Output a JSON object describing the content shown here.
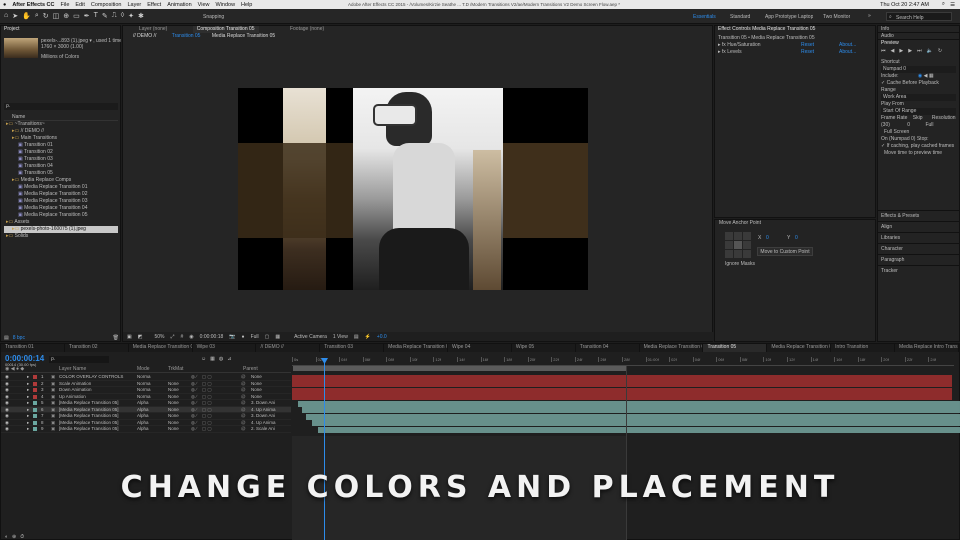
{
  "menubar": {
    "apple": "",
    "app": "After Effects CC",
    "items": [
      "File",
      "Edit",
      "Composition",
      "Layer",
      "Effect",
      "Animation",
      "View",
      "Window",
      "Help"
    ],
    "window_title": "Adobe After Effects CC 2015 - /Volumes/Kirzie Seathe ... T.D /Modern Transitions V2/ae/Modern Transitions V2 Demo Screen Flow.aep *",
    "datetime": "Thu Oct 20  2:47 AM"
  },
  "toolbar": {
    "snapping": "Snapping",
    "workspaces": [
      "Essentials",
      "Standard",
      "App Prototype Laptop",
      "Two Monitor"
    ],
    "search": "Search Help"
  },
  "project": {
    "tab": "Project",
    "thumb_name": "pexels-...893 (1).jpeg ▾ , used 1 time",
    "thumb_size": "1760 × 3000 (1.00)",
    "thumb_colors": "Millions of Colors",
    "search": "ρ.",
    "col_name": "Name",
    "items": [
      {
        "label": "~Transitions~",
        "indent": 0
      },
      {
        "label": "// DEMO //",
        "indent": 1
      },
      {
        "label": "Main Transitions",
        "indent": 1
      },
      {
        "label": "Transition 01",
        "indent": 2
      },
      {
        "label": "Transition 02",
        "indent": 2
      },
      {
        "label": "Transition 03",
        "indent": 2
      },
      {
        "label": "Transition 04",
        "indent": 2
      },
      {
        "label": "Transition 05",
        "indent": 2
      },
      {
        "label": "Media Replace Comps",
        "indent": 1
      },
      {
        "label": "Media Replace Transition 01",
        "indent": 2
      },
      {
        "label": "Media Replace Transition 02",
        "indent": 2
      },
      {
        "label": "Media Replace Transition 03",
        "indent": 2
      },
      {
        "label": "Media Replace Transition 04",
        "indent": 2
      },
      {
        "label": "Media Replace Transition 05",
        "indent": 2
      },
      {
        "label": "Assets",
        "indent": 0
      },
      {
        "label": "pexels-photo-160075 (1).jpeg",
        "indent": 1
      },
      {
        "label": "Solids",
        "indent": 0
      }
    ],
    "bpc": "8 bpc"
  },
  "viewer": {
    "tabs": [
      "Layer (none)",
      "Composition Transition 05",
      "Footage (none)"
    ],
    "breadcrumbs": [
      "// DEMO //",
      "Transition 05",
      "Media Replace Transition 05"
    ],
    "zoom": "50%",
    "timecode": "0:00:00:18",
    "resolution": "Full",
    "camera": "Active Camera",
    "views": "1 View",
    "offset": "+0.0"
  },
  "effects": {
    "tab": "Effect Controls Media Replace Transition 05",
    "header": "Transition 05 • Media Replace Transition 05",
    "rows": [
      {
        "name": "Hue/Saturation",
        "reset": "Reset",
        "about": "About..."
      },
      {
        "name": "Levels",
        "reset": "Reset",
        "about": "About..."
      }
    ],
    "anchor_title": "Move Anchor Point",
    "x_label": "X",
    "x_val": "0",
    "y_label": "Y",
    "y_val": "0",
    "move_button": "Move to Custom Point",
    "ignore_masks": "Ignore Masks"
  },
  "right": {
    "tabs": [
      "Info",
      "Audio"
    ],
    "preview_title": "Preview",
    "shortcut_label": "Shortcut",
    "shortcut_value": "Numpad 0",
    "include_label": "Include:",
    "cache_label": "Cache Before Playback",
    "range_label": "Range",
    "range_value": "Work Area",
    "playfrom_label": "Play From",
    "playfrom_value": "Start Of Range",
    "framerate_label": "Frame Rate",
    "skip_label": "Skip",
    "resolution_label": "Resolution",
    "framerate_value": "(30)",
    "skip_value": "0",
    "resolution_value": "Full",
    "fullscreen": "Full Screen",
    "onstop_label": "On (Numpad 0) Stop:",
    "ifcaching": "If caching, play cached frames",
    "movetime": "Move time to preview time",
    "panels": [
      "Effects & Presets",
      "Align",
      "Libraries",
      "Character",
      "Paragraph",
      "Tracker"
    ]
  },
  "timeline": {
    "tabs": [
      "Transition 01",
      "Transition 02",
      "Media Replace Transition 02",
      "Wipe 03",
      "// DEMO //",
      "Transition 03",
      "Media Replace Transition 03",
      "Wipe 04",
      "Wipe 05",
      "Transition 04",
      "Media Replace Transition 04",
      "Transition 05",
      "Media Replace Transition 05",
      "Intro Transition",
      "Media Replace Intro Trans"
    ],
    "active_tab": 11,
    "timecode": "0:00:00:14",
    "fps": "00014 (30.00 fps)",
    "search": "ρ.",
    "col_layer": "Layer Name",
    "col_mode": "Mode",
    "col_trkmat": "TrkMat",
    "col_parent": "Parent",
    "layers": [
      {
        "num": "1",
        "name": "COLOR OVERLAY CONTROLS",
        "mode": "Norma",
        "trk": "",
        "parent": "None",
        "color": "#b03a3a"
      },
      {
        "num": "2",
        "name": "Scale Animation",
        "mode": "Norma",
        "trk": "None",
        "parent": "None",
        "color": "#b03a3a"
      },
      {
        "num": "3",
        "name": "Down Animation",
        "mode": "Norma",
        "trk": "None",
        "parent": "None",
        "color": "#b03a3a"
      },
      {
        "num": "4",
        "name": "Up Animation",
        "mode": "Norma",
        "trk": "None",
        "parent": "None",
        "color": "#b03a3a"
      },
      {
        "num": "5",
        "name": "[Media Replace Transition 05]",
        "mode": "Alpha",
        "trk": "None",
        "parent": "3. Down Ani",
        "color": "#6aa7a0"
      },
      {
        "num": "6",
        "name": "[Media Replace Transition 05]",
        "mode": "Alpha",
        "trk": "None",
        "parent": "4. Up Anima",
        "color": "#6aa7a0"
      },
      {
        "num": "7",
        "name": "[Media Replace Transition 05]",
        "mode": "Alpha",
        "trk": "None",
        "parent": "3. Down Ani",
        "color": "#6aa7a0"
      },
      {
        "num": "8",
        "name": "[Media Replace Transition 05]",
        "mode": "Alpha",
        "trk": "None",
        "parent": "4. Up Anima",
        "color": "#6aa7a0"
      },
      {
        "num": "9",
        "name": "[Media Replace Transition 05]",
        "mode": "Alpha",
        "trk": "None",
        "parent": "2. Scale Ani",
        "color": "#6aa7a0"
      }
    ],
    "ruler": [
      "0s",
      "02f",
      "04f",
      "06f",
      "08f",
      "10f",
      "12f",
      "14f",
      "16f",
      "18f",
      "20f",
      "22f",
      "24f",
      "26f",
      "28f",
      "01:00f",
      "02f",
      "04f",
      "06f",
      "08f",
      "10f",
      "12f",
      "14f",
      "16f",
      "18f",
      "20f",
      "22f",
      "24f"
    ]
  },
  "caption": "CHANGE COLORS AND PLACEMENT",
  "colors": {
    "accent": "#2d8ceb",
    "red_layer": "#8e2c2c",
    "teal_layer": "#6f9c97"
  }
}
